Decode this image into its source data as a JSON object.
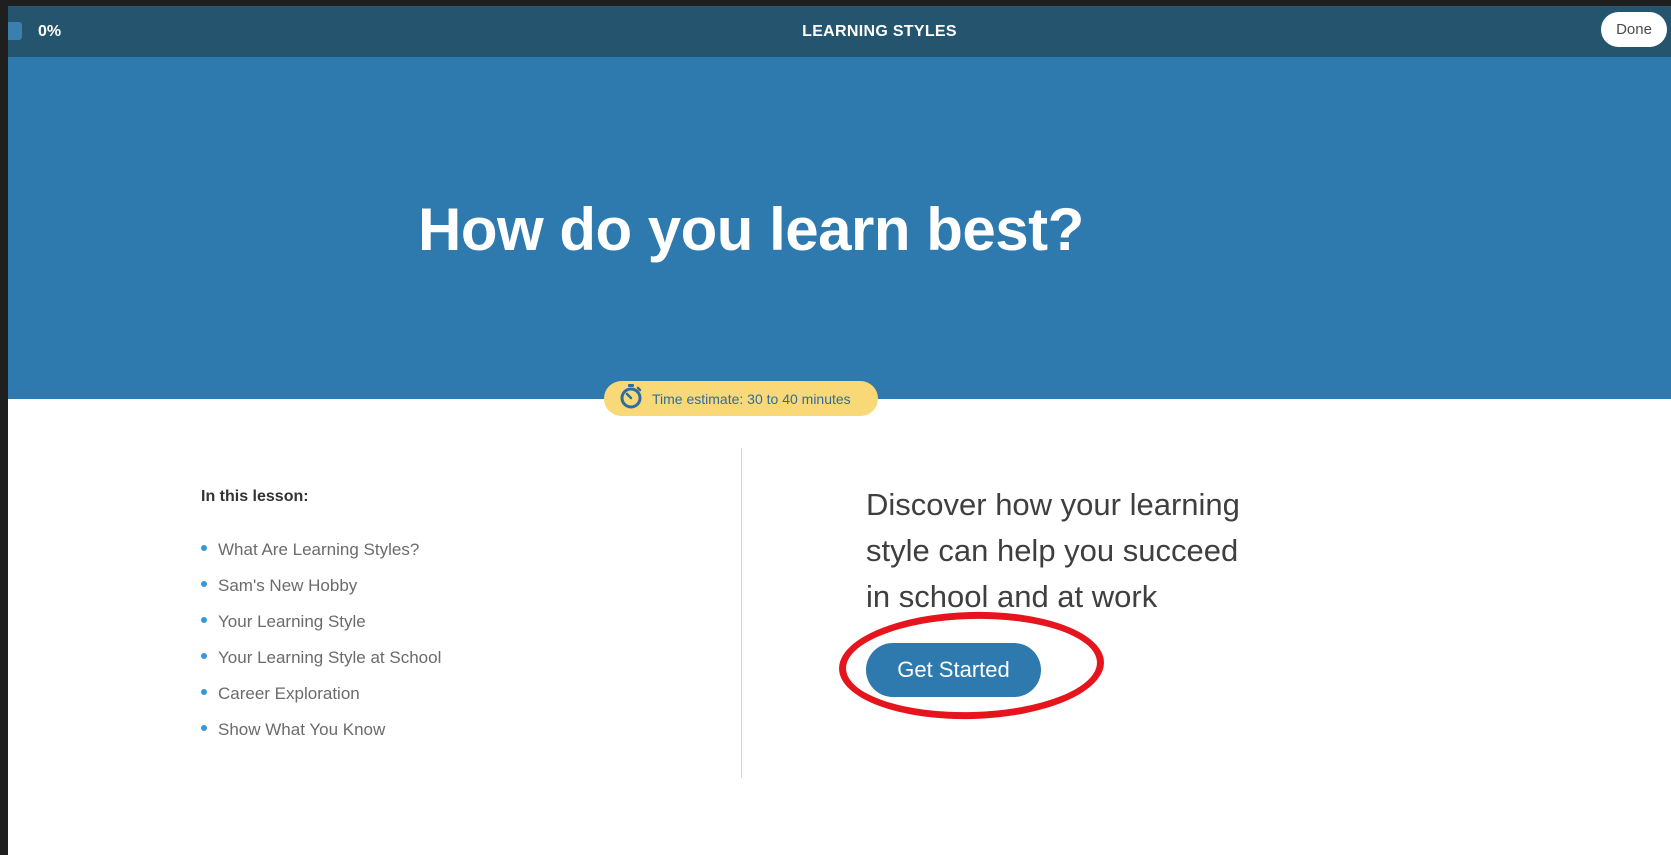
{
  "header": {
    "progress_label": "0%",
    "progress_value": 0,
    "title": "LEARNING STYLES",
    "done_label": "Done"
  },
  "hero": {
    "title": "How do you learn best?"
  },
  "time_estimate": {
    "icon": "stopwatch-icon",
    "text": "Time estimate: 30 to 40 minutes"
  },
  "lesson": {
    "heading": "In this lesson:",
    "items": [
      "What Are Learning Styles?",
      "Sam's New Hobby",
      "Your Learning Style",
      "Your Learning Style at School",
      "Career Exploration",
      "Show What You Know"
    ]
  },
  "intro": {
    "tagline_lines": [
      "Discover how your learning",
      "style can help you succeed",
      "in school and at work"
    ],
    "cta_label": "Get Started"
  },
  "colors": {
    "topbar": "#25556e",
    "hero": "#2e79ae",
    "pill": "#f8d877",
    "highlight": "#e6151d"
  }
}
